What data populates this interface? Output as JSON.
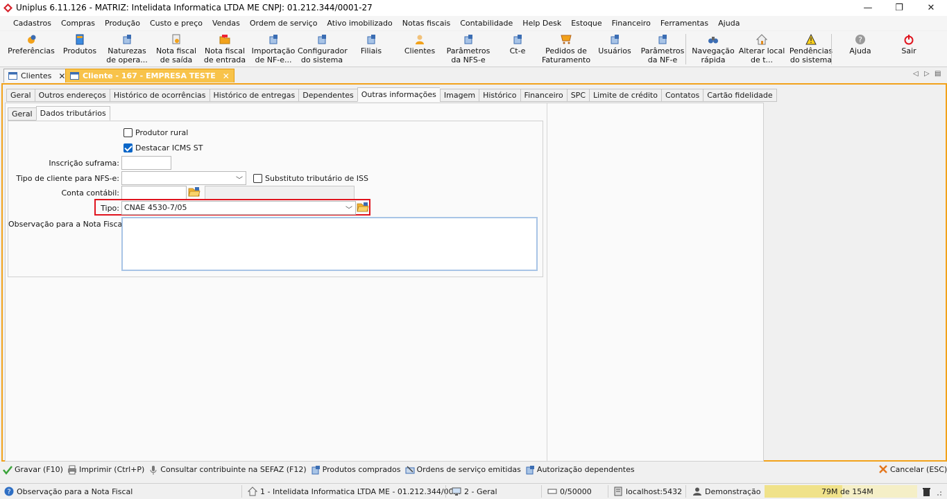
{
  "window": {
    "title": "Uniplus 6.11.126 - MATRIZ: Intelidata Informatica LTDA ME CNPJ: 01.212.344/0001-27",
    "controls": {
      "minimize": "—",
      "maximize": "❐",
      "close": "✕"
    }
  },
  "menu": [
    "Cadastros",
    "Compras",
    "Produção",
    "Custo e preço",
    "Vendas",
    "Ordem de serviço",
    "Ativo imobilizado",
    "Notas fiscais",
    "Contabilidade",
    "Help Desk",
    "Estoque",
    "Financeiro",
    "Ferramentas",
    "Ajuda"
  ],
  "toolbar": [
    {
      "label": "Preferências",
      "icon": "gear-icon"
    },
    {
      "label": "Produtos",
      "icon": "box-icon"
    },
    {
      "label": "Naturezas\nde opera...",
      "icon": "document-icon"
    },
    {
      "label": "Nota fiscal\nde saída",
      "icon": "invoice-icon"
    },
    {
      "label": "Nota fiscal\nde entrada",
      "icon": "folder-icon"
    },
    {
      "label": "Importação\nde NF-e...",
      "icon": "document-icon"
    },
    {
      "label": "Configurador\ndo sistema",
      "icon": "document-icon"
    },
    {
      "label": "Filiais",
      "icon": "document-icon"
    },
    {
      "label": "Clientes",
      "icon": "person-icon"
    },
    {
      "label": "Parâmetros\nda NFS-e",
      "icon": "document-icon"
    },
    {
      "label": "Ct-e",
      "icon": "document-icon"
    },
    {
      "label": "Pedidos de\nFaturamento",
      "icon": "cart-icon"
    },
    {
      "label": "Usuários",
      "icon": "document-icon"
    },
    {
      "label": "Parâmetros\nda NF-e",
      "icon": "document-icon"
    },
    {
      "label": "Navegação\nrápida",
      "icon": "binoculars-icon"
    },
    {
      "label": "Alterar local\nde t...",
      "icon": "home-icon"
    },
    {
      "label": "Pendências\ndo sistema",
      "icon": "warning-icon"
    },
    {
      "label": "Ajuda",
      "icon": "help-icon"
    },
    {
      "label": "Sair",
      "icon": "power-icon"
    }
  ],
  "doc_tabs": [
    {
      "label": "Clientes",
      "active": false
    },
    {
      "label": "Cliente - 167 - EMPRESA TESTE",
      "active": true
    }
  ],
  "doc_nav": {
    "left": "◁",
    "right": "▷",
    "menu": "▤"
  },
  "tabs": [
    "Geral",
    "Outros endereços",
    "Histórico de ocorrências",
    "Histórico de entregas",
    "Dependentes",
    "Outras informações",
    "Imagem",
    "Histórico",
    "Financeiro",
    "SPC",
    "Limite de crédito",
    "Contatos",
    "Cartão fidelidade"
  ],
  "active_tab": "Outras informações",
  "subtabs": [
    "Geral",
    "Dados tributários"
  ],
  "active_subtab": "Dados tributários",
  "form": {
    "produtor_rural": {
      "label": "Produtor rural",
      "checked": false
    },
    "destacar_icms": {
      "label": "Destacar ICMS ST",
      "checked": true
    },
    "inscricao_suframa": {
      "label": "Inscrição suframa:",
      "value": ""
    },
    "tipo_cliente_nfse": {
      "label": "Tipo de cliente para NFS-e:",
      "value": ""
    },
    "substituto_iss": {
      "label": "Substituto tributário de ISS",
      "checked": false
    },
    "conta_contabil": {
      "label": "Conta contábil:",
      "value": "",
      "description": ""
    },
    "tipo": {
      "label": "Tipo:",
      "value": "CNAE 4530-7/05"
    },
    "observacao": {
      "label": "Observação para a Nota Fiscal:",
      "value": ""
    }
  },
  "highlight_color": "#e0141e",
  "actions": [
    {
      "label": "Gravar (F10)",
      "icon": "check-icon"
    },
    {
      "label": "Imprimir (Ctrl+P)",
      "icon": "printer-icon"
    },
    {
      "label": "Consultar contribuinte na SEFAZ (F12)",
      "icon": "microphone-icon"
    },
    {
      "label": "Produtos comprados",
      "icon": "document-icon"
    },
    {
      "label": "Ordens de serviço emitidas",
      "icon": "tools-icon"
    },
    {
      "label": "Autorização dependentes",
      "icon": "document-icon"
    }
  ],
  "cancel": {
    "label": "Cancelar (ESC)",
    "icon": "cancel-icon"
  },
  "status": {
    "hint": "Observação para a Nota Fiscal",
    "company": "1 - Intelidata Informatica LTDA ME - 01.212.344/00...",
    "terminal": "2 - Geral",
    "counter": "0/50000",
    "server": "localhost:5432",
    "user": "Demonstração",
    "memory": "79M de 154M",
    "memory_used_fraction": 0.51
  }
}
